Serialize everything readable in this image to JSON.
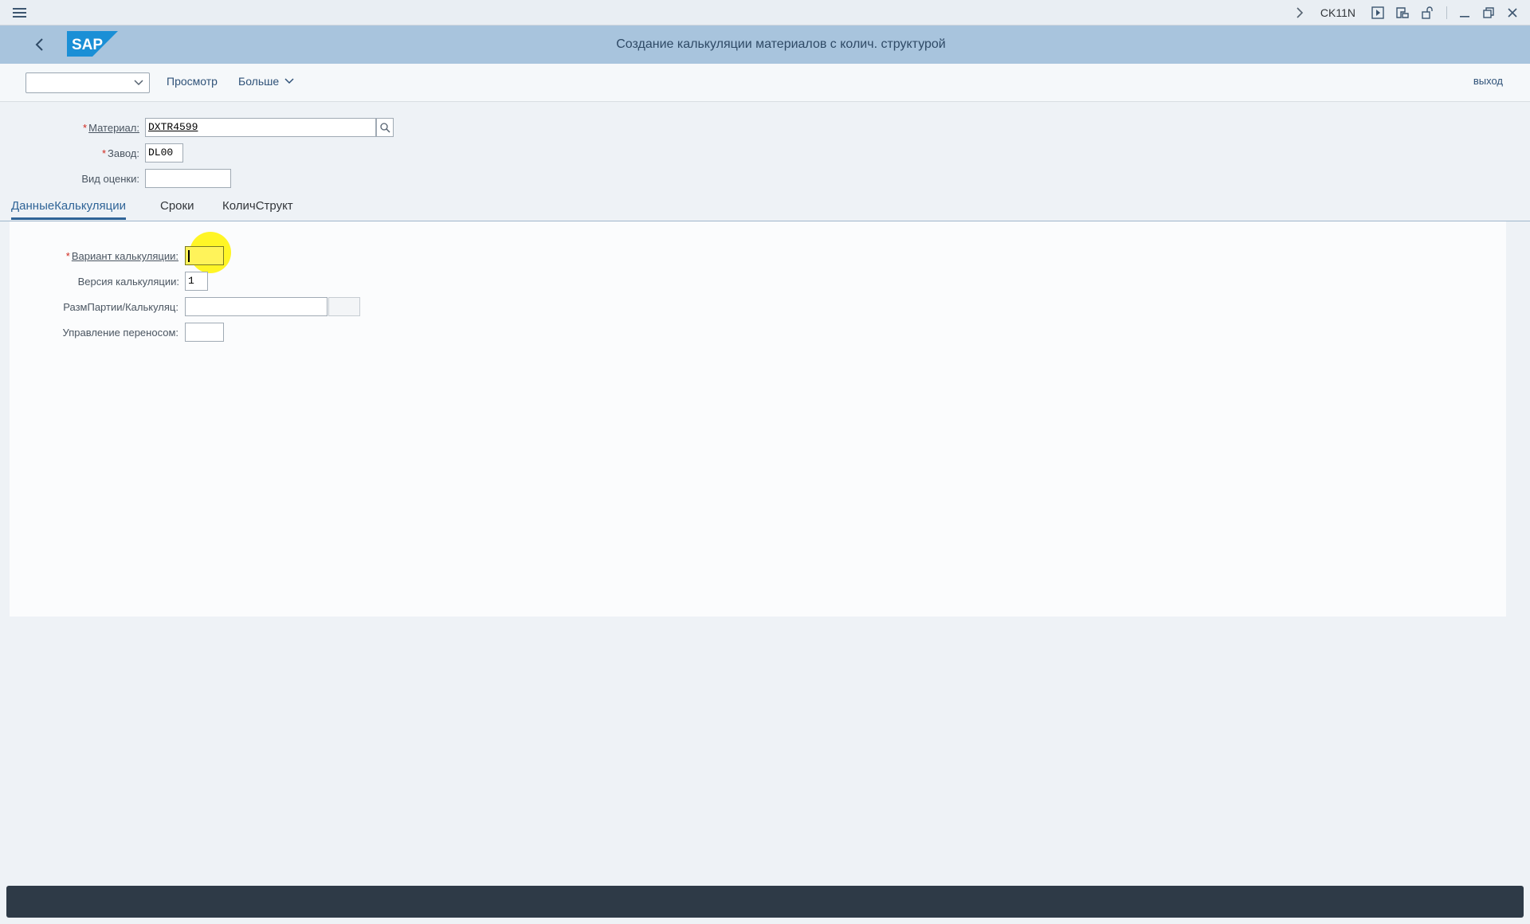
{
  "system_bar": {
    "tcode": "CK11N",
    "icons": [
      "menu-icon",
      "chevron-right-icon",
      "execute-icon",
      "layout-icon",
      "lock-icon",
      "minimize-icon",
      "maximize-icon",
      "close-icon"
    ]
  },
  "shell": {
    "logo_text": "SAP",
    "title": "Создание калькуляции материалов с колич. структурой"
  },
  "toolbar": {
    "select_value": "",
    "view_label": "Просмотр",
    "more_label": "Больше",
    "exit_label": "выход"
  },
  "header": {
    "material": {
      "label": "Материал:",
      "value": "DXTR4599",
      "required": true
    },
    "plant": {
      "label": "Завод:",
      "value": "DL00",
      "required": true
    },
    "valuation_type": {
      "label": "Вид оценки:",
      "value": ""
    }
  },
  "tabs": [
    {
      "label": "ДанныеКалькуляции",
      "active": true
    },
    {
      "label": "Сроки",
      "active": false
    },
    {
      "label": "КоличСтрукт",
      "active": false
    }
  ],
  "costing": {
    "variant": {
      "label": "Вариант калькуляции:",
      "value": "",
      "required": true
    },
    "version": {
      "label": "Версия калькуляции:",
      "value": "1"
    },
    "lot_size": {
      "label": "РазмПартии/Калькуляц:",
      "value": "",
      "unit": ""
    },
    "transfer_control": {
      "label": "Управление переносом:",
      "value": ""
    }
  },
  "colors": {
    "shell_bg": "#a8c4dd",
    "accent": "#2f6497",
    "required": "#d0271d",
    "highlight": "#fff35a",
    "statusbar": "#2e3a47"
  }
}
